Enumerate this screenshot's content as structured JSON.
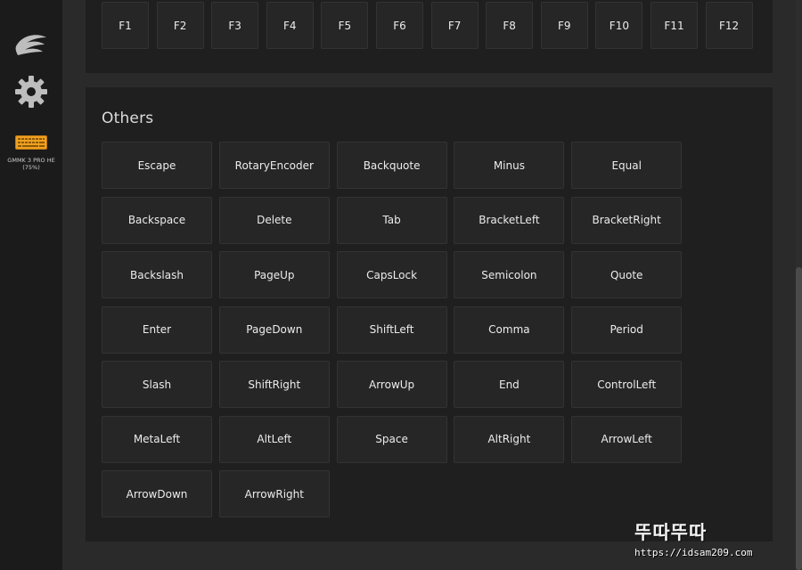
{
  "sidebar": {
    "logo_icon": "feather-logo-icon",
    "settings_icon": "gear-icon",
    "device": {
      "icon": "keyboard-icon",
      "name": "GMMK 3 PRO HE (75%)"
    }
  },
  "function_keys": [
    "F1",
    "F2",
    "F3",
    "F4",
    "F5",
    "F6",
    "F7",
    "F8",
    "F9",
    "F10",
    "F11",
    "F12"
  ],
  "others": {
    "title": "Others",
    "keys": [
      "Escape",
      "RotaryEncoder",
      "Backquote",
      "Minus",
      "Equal",
      "Backspace",
      "Delete",
      "Tab",
      "BracketLeft",
      "BracketRight",
      "Backslash",
      "PageUp",
      "CapsLock",
      "Semicolon",
      "Quote",
      "Enter",
      "PageDown",
      "ShiftLeft",
      "Comma",
      "Period",
      "Slash",
      "ShiftRight",
      "ArrowUp",
      "End",
      "ControlLeft",
      "MetaLeft",
      "AltLeft",
      "Space",
      "AltRight",
      "ArrowLeft",
      "ArrowDown",
      "ArrowRight"
    ]
  },
  "watermark": {
    "title": "뚜따뚜따",
    "url": "https://idsam209.com"
  },
  "colors": {
    "background": "#262626",
    "sidebar": "#1b1b1b",
    "panel": "#1f1f1f",
    "key": "#262626",
    "keyboard_accent": "#f0a020"
  }
}
